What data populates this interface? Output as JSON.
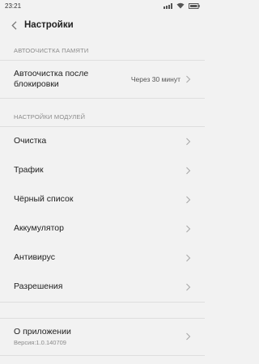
{
  "status_bar": {
    "time": "23:21"
  },
  "header": {
    "title": "Настройки"
  },
  "sections": {
    "memory_cleanup": {
      "header": "АВТООЧИСТКА ПАМЯТИ",
      "autoclean_label_line1": "Автоочистка после",
      "autoclean_label_line2": "блокировки",
      "autoclean_value": "Через 30 минут"
    },
    "modules": {
      "header": "НАСТРОЙКИ МОДУЛЕЙ",
      "items": [
        {
          "label": "Очистка"
        },
        {
          "label": "Трафик"
        },
        {
          "label": "Чёрный список"
        },
        {
          "label": "Аккумулятор"
        },
        {
          "label": "Антивирус"
        },
        {
          "label": "Разрешения"
        }
      ]
    },
    "about": {
      "label": "О приложении",
      "version": "Версия:1.0.140709"
    }
  },
  "icons": {
    "back": "chevron-left-icon",
    "row_arrow": "chevron-right-icon",
    "signal": "signal-icon",
    "wifi": "wifi-icon",
    "battery": "battery-icon"
  }
}
